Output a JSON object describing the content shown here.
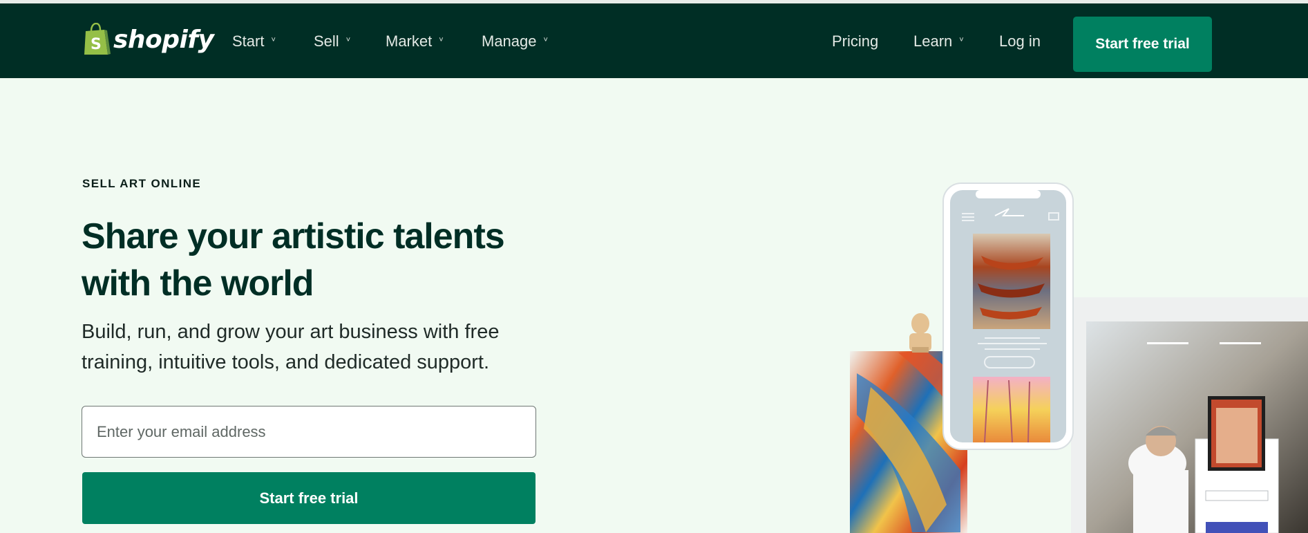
{
  "brand": {
    "name": "shopify",
    "color": "#95bf47"
  },
  "nav": {
    "items": [
      {
        "label": "Start",
        "chevron": "chevron-down-icon"
      },
      {
        "label": "Sell",
        "chevron": "chevron-down-icon"
      },
      {
        "label": "Market",
        "chevron": "chevron-down-icon"
      },
      {
        "label": "Manage",
        "chevron": "chevron-down-icon"
      }
    ],
    "pricing": "Pricing",
    "learn": "Learn",
    "login": "Log in",
    "cta": "Start free trial"
  },
  "hero": {
    "eyebrow": "SELL ART ONLINE",
    "title_line1": "Share your artistic talents",
    "title_line2": "with the world",
    "subtitle_line1": "Build, run, and grow your art business with free",
    "subtitle_line2": "training, intuitive tools, and dedicated support.",
    "email_placeholder": "Enter your email address",
    "cta": "Start free trial"
  },
  "colors": {
    "header_bg": "#002e25",
    "accent": "#008060",
    "page_bg": "#f1faf2"
  }
}
